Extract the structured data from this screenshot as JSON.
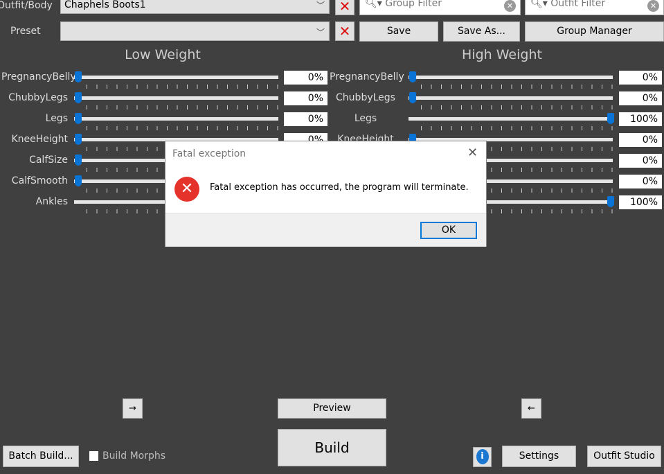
{
  "top": {
    "outfit_label": "Outfit/Body",
    "outfit_value": "Chaphels Boots1",
    "preset_label": "Preset",
    "preset_value": "",
    "group_filter_placeholder": "Group Filter",
    "outfit_filter_placeholder": "Outfit Filter",
    "save": "Save",
    "save_as": "Save As...",
    "group_manager": "Group Manager"
  },
  "low": {
    "title": "Low Weight",
    "sliders": [
      {
        "name": "PregnancyBelly",
        "value": "0%",
        "level": 0
      },
      {
        "name": "ChubbyLegs",
        "value": "0%",
        "level": 0
      },
      {
        "name": "Legs",
        "value": "0%",
        "level": 0
      },
      {
        "name": "KneeHeight",
        "value": "0%",
        "level": 0
      },
      {
        "name": "CalfSize",
        "value": "",
        "level": 0
      },
      {
        "name": "CalfSmooth",
        "value": "",
        "level": 0
      },
      {
        "name": "Ankles",
        "value": "",
        "level": null
      }
    ]
  },
  "high": {
    "title": "High Weight",
    "sliders": [
      {
        "name": "PregnancyBelly",
        "value": "0%",
        "level": 0
      },
      {
        "name": "ChubbyLegs",
        "value": "0%",
        "level": 0
      },
      {
        "name": "Legs",
        "value": "100%",
        "level": 100
      },
      {
        "name": "KneeHeight",
        "value": "0%",
        "level": 0
      },
      {
        "name": "CalfSize",
        "value": "0%",
        "level": 0
      },
      {
        "name": "CalfSmooth",
        "value": "0%",
        "level": 0
      },
      {
        "name": "Ankles",
        "value": "100%",
        "level": 100
      }
    ]
  },
  "bottom": {
    "copy_right": "→",
    "copy_left": "←",
    "preview": "Preview",
    "build": "Build",
    "batch_build": "Batch Build...",
    "build_morphs": "Build Morphs",
    "build_morphs_checked": false,
    "settings": "Settings",
    "outfit_studio": "Outfit Studio"
  },
  "dialog": {
    "title": "Fatal exception",
    "message": "Fatal exception has occurred, the program will terminate.",
    "ok": "OK",
    "icon": "error-icon"
  }
}
